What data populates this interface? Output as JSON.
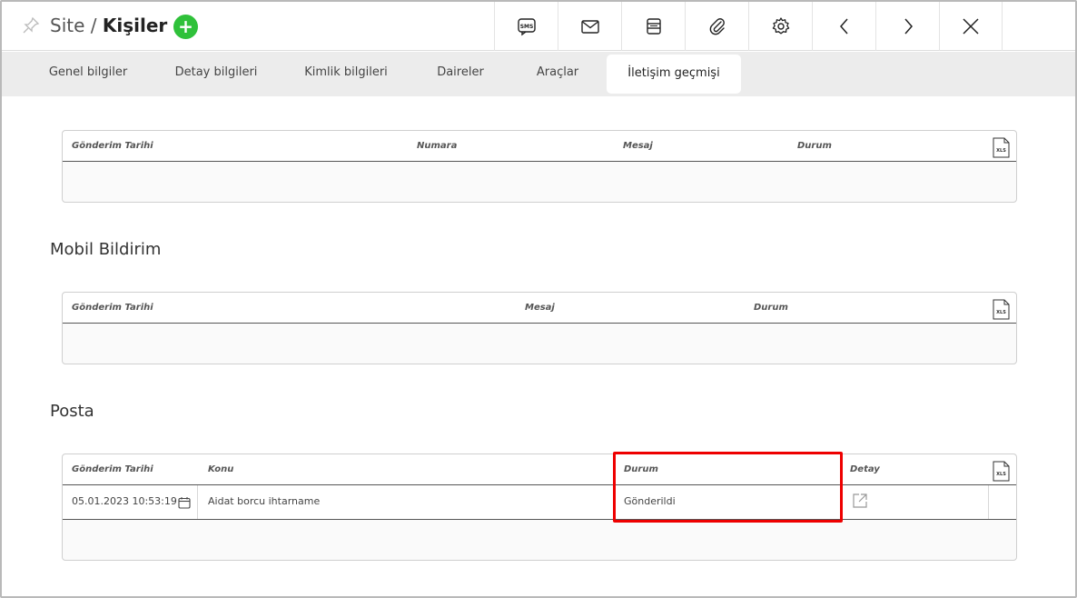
{
  "header": {
    "title_prefix": "Site / ",
    "title_strong": "Kişiler",
    "add_label": "+",
    "tools": [
      "sms-icon",
      "mail-icon",
      "print-icon",
      "attach-icon",
      "gear-icon",
      "chevron-left-icon",
      "chevron-right-icon",
      "close-icon"
    ]
  },
  "tabs": [
    {
      "label": "Genel bilgiler",
      "active": false
    },
    {
      "label": "Detay bilgileri",
      "active": false
    },
    {
      "label": "Kimlik bilgileri",
      "active": false
    },
    {
      "label": "Daireler",
      "active": false
    },
    {
      "label": "Araçlar",
      "active": false
    },
    {
      "label": "İletişim geçmişi",
      "active": true
    }
  ],
  "sms_table": {
    "columns": [
      "Gönderim Tarihi",
      "Numara",
      "Mesaj",
      "Durum"
    ],
    "export_label": "XLS"
  },
  "mobile": {
    "title": "Mobil Bildirim",
    "columns": [
      "Gönderim Tarihi",
      "Mesaj",
      "Durum"
    ],
    "export_label": "XLS"
  },
  "post": {
    "title": "Posta",
    "columns": [
      "Gönderim Tarihi",
      "Konu",
      "Durum",
      "Detay"
    ],
    "export_label": "XLS",
    "rows": [
      {
        "date": "05.01.2023 10:53:19",
        "subject": "Aidat borcu ihtarname",
        "status": "Gönderildi"
      }
    ]
  },
  "colors": {
    "accent_green": "#2fc13a",
    "highlight_red": "#ee0000"
  }
}
